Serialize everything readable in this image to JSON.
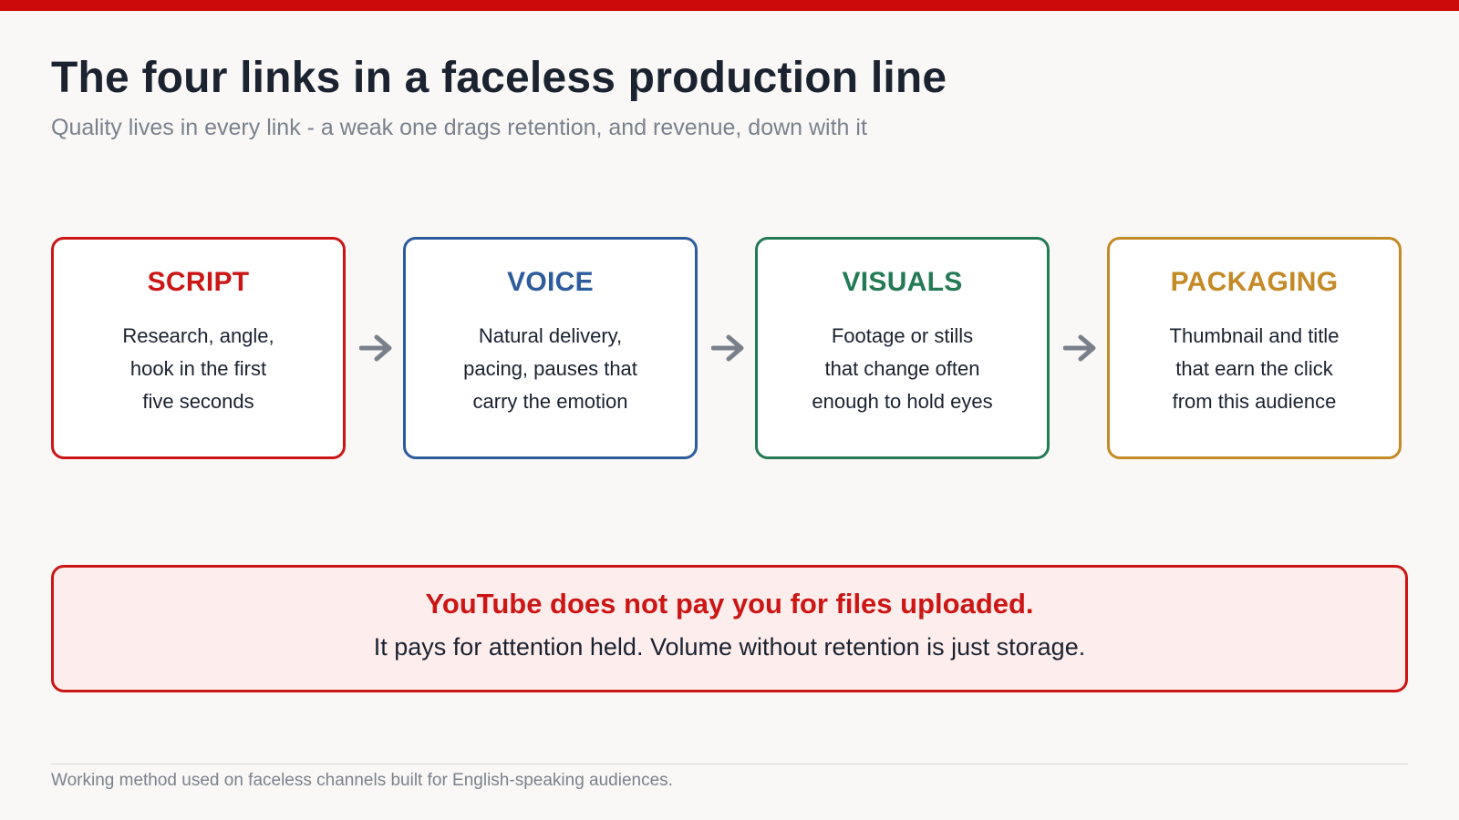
{
  "header": {
    "title": "The four links in a faceless production line",
    "subtitle": "Quality lives in every link - a weak one drags retention, and revenue, down with it"
  },
  "steps": [
    {
      "title": "SCRIPT",
      "lines": [
        "Research, angle,",
        "hook in the first",
        "five seconds"
      ],
      "color": "#cc1616"
    },
    {
      "title": "VOICE",
      "lines": [
        "Natural delivery,",
        "pacing, pauses that",
        "carry the emotion"
      ],
      "color": "#2d5c9c"
    },
    {
      "title": "VISUALS",
      "lines": [
        "Footage or stills",
        "that change often",
        "enough to hold eyes"
      ],
      "color": "#237a55"
    },
    {
      "title": "PACKAGING",
      "lines": [
        "Thumbnail and title",
        "that earn the click",
        "from this audience"
      ],
      "color": "#c48a26"
    }
  ],
  "arrow_icon": "arrow-right-icon",
  "callout": {
    "headline": "YouTube does not pay you for files uploaded.",
    "body": "It pays for attention held. Volume without retention is just storage."
  },
  "footer": {
    "note": "Working method used on faceless channels built for English-speaking audiences."
  },
  "colors": {
    "accent": "#cc0a0a",
    "arrow": "#7a808a",
    "callout_bg": "#fdeeed"
  }
}
